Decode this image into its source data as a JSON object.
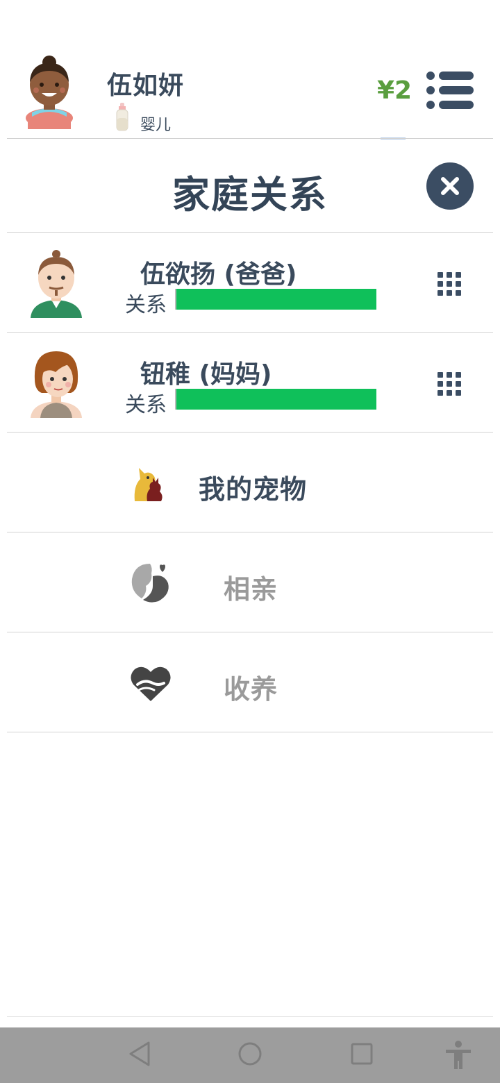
{
  "header": {
    "player_name": "伍如妍",
    "stage": "婴儿",
    "money": "¥2",
    "menu_icon": "menu-list-icon",
    "money_color": "#5a9e3f"
  },
  "page": {
    "title": "家庭关系",
    "close_icon": "close-icon"
  },
  "relations": [
    {
      "name": "伍欲扬 (爸爸)",
      "relation_label": "关系",
      "relation_level": 1.0,
      "bar_color": "#0fc05a"
    },
    {
      "name": "钮稚 (妈妈)",
      "relation_label": "关系",
      "relation_level": 1.0,
      "bar_color": "#0fc05a"
    }
  ],
  "actions": [
    {
      "label": "我的宠物",
      "icon": "pet-icon",
      "enabled": true
    },
    {
      "label": "相亲",
      "icon": "matchmaking-icon",
      "enabled": false
    },
    {
      "label": "收养",
      "icon": "adoption-icon",
      "enabled": false
    }
  ],
  "navbar": {
    "icons": [
      "back-icon",
      "home-icon",
      "recents-icon",
      "accessibility-icon"
    ]
  }
}
